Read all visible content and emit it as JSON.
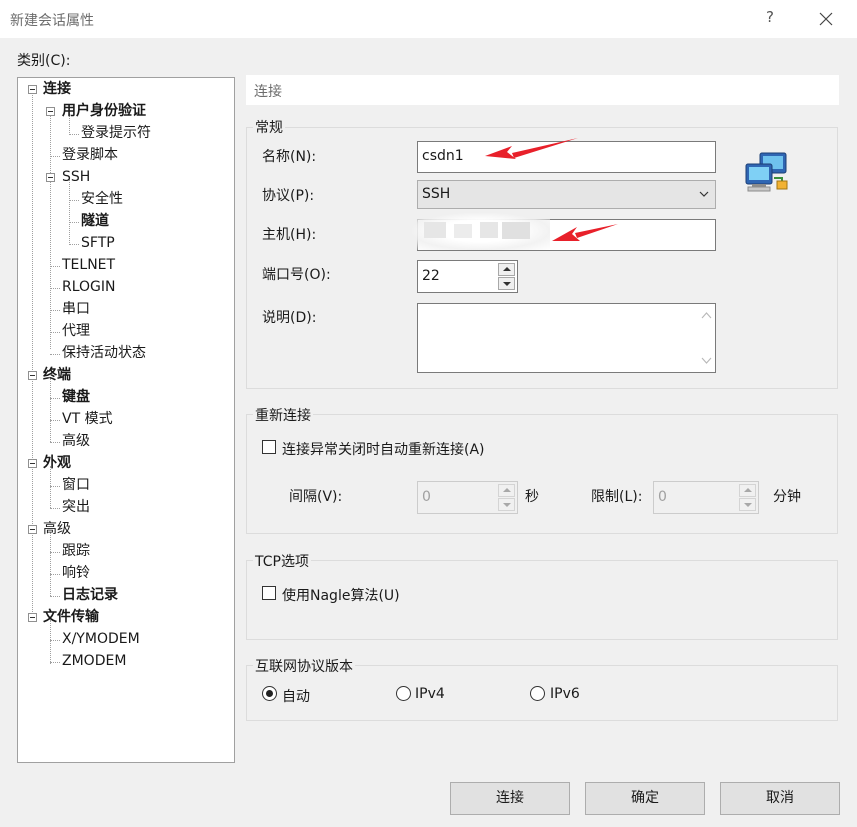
{
  "window": {
    "title": "新建会话属性",
    "help_glyph": "?"
  },
  "category_label": "类别(C):",
  "tree": [
    {
      "label": "连接",
      "bold": true
    },
    {
      "label": "用户身份验证",
      "bold": true
    },
    {
      "label": "登录提示符",
      "bold": false
    },
    {
      "label": "登录脚本",
      "bold": false
    },
    {
      "label": "SSH",
      "bold": false
    },
    {
      "label": "安全性",
      "bold": false
    },
    {
      "label": "隧道",
      "bold": true
    },
    {
      "label": "SFTP",
      "bold": false
    },
    {
      "label": "TELNET",
      "bold": false
    },
    {
      "label": "RLOGIN",
      "bold": false
    },
    {
      "label": "串口",
      "bold": false
    },
    {
      "label": "代理",
      "bold": false
    },
    {
      "label": "保持活动状态",
      "bold": false
    },
    {
      "label": "终端",
      "bold": true
    },
    {
      "label": "键盘",
      "bold": true
    },
    {
      "label": "VT 模式",
      "bold": false
    },
    {
      "label": "高级",
      "bold": false
    },
    {
      "label": "外观",
      "bold": true
    },
    {
      "label": "窗口",
      "bold": false
    },
    {
      "label": "突出",
      "bold": false
    },
    {
      "label": "高级",
      "bold": false
    },
    {
      "label": "跟踪",
      "bold": false
    },
    {
      "label": "响铃",
      "bold": false
    },
    {
      "label": "日志记录",
      "bold": true
    },
    {
      "label": "文件传输",
      "bold": true
    },
    {
      "label": "X/YMODEM",
      "bold": false
    },
    {
      "label": "ZMODEM",
      "bold": false
    }
  ],
  "panel": {
    "header": "连接",
    "general": {
      "title": "常规",
      "name_label": "名称(N):",
      "name_value": "csdn1",
      "protocol_label": "协议(P):",
      "protocol_value": "SSH",
      "host_label": "主机(H):",
      "host_value": "",
      "port_label": "端口号(O):",
      "port_value": "22",
      "desc_label": "说明(D):",
      "desc_value": ""
    },
    "reconnect": {
      "title": "重新连接",
      "checkbox_label": "连接异常关闭时自动重新连接(A)",
      "checked": false,
      "interval_label": "间隔(V):",
      "interval_value": "0",
      "interval_unit": "秒",
      "limit_label": "限制(L):",
      "limit_value": "0",
      "limit_unit": "分钟"
    },
    "tcp": {
      "title": "TCP选项",
      "nagle_label": "使用Nagle算法(U)",
      "checked": false
    },
    "ipver": {
      "title": "互联网协议版本",
      "options": [
        "自动",
        "IPv4",
        "IPv6"
      ],
      "selected": "自动"
    }
  },
  "buttons": {
    "connect": "连接",
    "ok": "确定",
    "cancel": "取消"
  },
  "colors": {
    "annotation_arrow": "#e8202a",
    "dialog_bg": "#f0f0f0"
  }
}
